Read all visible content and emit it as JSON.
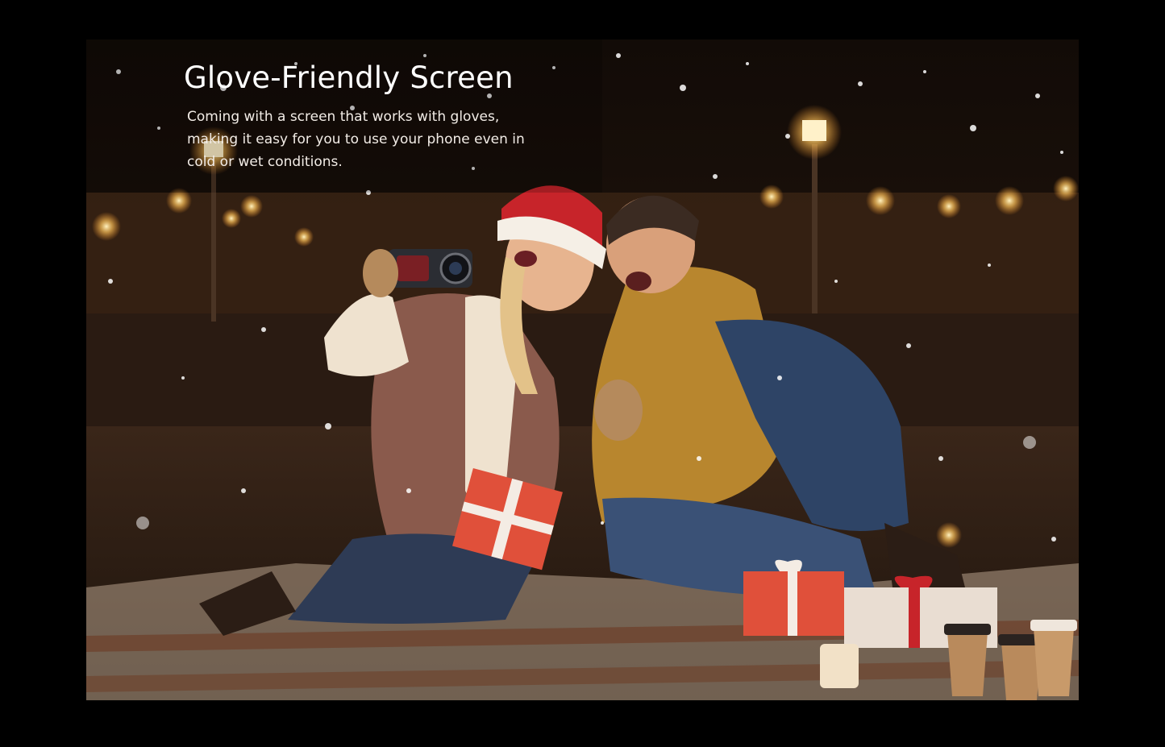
{
  "feature": {
    "title": "Glove-Friendly Screen",
    "description": "Coming with a screen that works with gloves, making it easy for you to use your phone even in cold or wet conditions."
  },
  "photo": {
    "scene": "couple-selfie-snowy-night",
    "accent_colors": {
      "background": "#000000",
      "lights": "#ffcf6a",
      "gift_red": "#e0503a",
      "jacket_mustard": "#b8862e",
      "santa_hat": "#c7242a"
    }
  }
}
